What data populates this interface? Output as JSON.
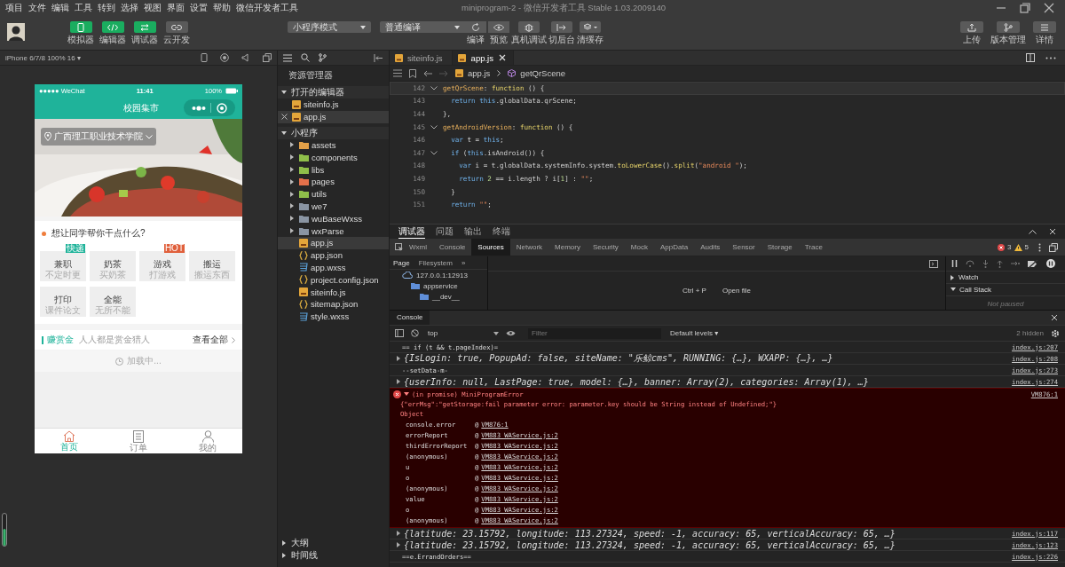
{
  "menu": [
    "项目",
    "文件",
    "编辑",
    "工具",
    "转到",
    "选择",
    "视图",
    "界面",
    "设置",
    "帮助",
    "微信开发者工具"
  ],
  "window": {
    "title": "miniprogram-2 - 微信开发者工具 Stable 1.03.2009140"
  },
  "toolbar": {
    "left_buttons": [
      {
        "label": "模拟器",
        "kind": "phone",
        "on": true
      },
      {
        "label": "编辑器",
        "kind": "code",
        "on": true
      },
      {
        "label": "调试器",
        "kind": "debug",
        "on": true
      },
      {
        "label": "云开发",
        "kind": "cloud",
        "on": false
      }
    ],
    "mode": "小程序模式",
    "compile": "普通编译",
    "actions": [
      {
        "label": "编译",
        "kind": "refresh"
      },
      {
        "label": "预览",
        "kind": "eye"
      },
      {
        "label": "真机调试",
        "kind": "bug"
      },
      {
        "label": "切后台",
        "kind": "switch"
      },
      {
        "label": "清缓存",
        "kind": "layers"
      }
    ],
    "right_buttons": [
      {
        "label": "上传",
        "kind": "upload"
      },
      {
        "label": "版本管理",
        "kind": "branch"
      },
      {
        "label": "详情",
        "kind": "menu"
      }
    ]
  },
  "simulator": {
    "device": "iPhone 6/7/8 100% 16 ▾",
    "phone": {
      "carrier": "●●●●● WeChat",
      "time": "11:41",
      "battery": "100%",
      "title": "校园集市",
      "location": "广西理工职业技术学院",
      "question": "想让同学帮你干点什么?",
      "services": [
        {
          "title": "兼职",
          "sub": "不定时更",
          "badge": "快递",
          "color": "#1fb39a"
        },
        {
          "title": "奶茶",
          "sub": "买奶茶"
        },
        {
          "title": "游戏",
          "sub": "打游戏",
          "badge": "HOT",
          "color": "#e0603c"
        },
        {
          "title": "搬运",
          "sub": "搬运东西"
        },
        {
          "title": "打印",
          "sub": "课件论文"
        },
        {
          "title": "全能",
          "sub": "无所不能"
        }
      ],
      "bounty": {
        "title": "赚赏金",
        "sub": "人人都是赏金猎人",
        "more": "查看全部",
        "loading": "加载中..."
      },
      "tabbar": [
        {
          "label": "首页",
          "kind": "home",
          "selected": true
        },
        {
          "label": "订单",
          "kind": "list",
          "selected": false
        },
        {
          "label": "我的",
          "kind": "user",
          "selected": false
        }
      ]
    }
  },
  "explorer": {
    "title": "资源管理器",
    "sections": [
      {
        "title": "打开的编辑器",
        "expanded": true,
        "items": [
          {
            "name": "siteinfo.js",
            "kind": "js",
            "selected": false
          },
          {
            "name": "app.js",
            "kind": "js",
            "selected": true
          }
        ]
      },
      {
        "title": "小程序",
        "expanded": true,
        "items": [
          {
            "name": "assets",
            "kind": "folder",
            "color": "#e3a048",
            "selected": false
          },
          {
            "name": "components",
            "kind": "folder",
            "color": "#8fbf4a",
            "selected": false
          },
          {
            "name": "libs",
            "kind": "folder",
            "color": "#8fbf4a",
            "selected": false
          },
          {
            "name": "pages",
            "kind": "folder",
            "color": "#e3704a",
            "selected": false
          },
          {
            "name": "utils",
            "kind": "folder",
            "color": "#8fbf4a",
            "selected": false
          },
          {
            "name": "we7",
            "kind": "folder",
            "color": "#8a95a3",
            "selected": false
          },
          {
            "name": "wuBaseWxss",
            "kind": "folder",
            "color": "#8a95a3",
            "selected": false
          },
          {
            "name": "wxParse",
            "kind": "folder",
            "color": "#8a95a3",
            "selected": false
          },
          {
            "name": "app.js",
            "kind": "js",
            "selected": true
          },
          {
            "name": "app.json",
            "kind": "json",
            "selected": false
          },
          {
            "name": "app.wxss",
            "kind": "wxss",
            "selected": false
          },
          {
            "name": "project.config.json",
            "kind": "json",
            "selected": false
          },
          {
            "name": "siteinfo.js",
            "kind": "js",
            "selected": false
          },
          {
            "name": "sitemap.json",
            "kind": "json",
            "selected": false
          },
          {
            "name": "style.wxss",
            "kind": "wxss",
            "selected": false
          }
        ]
      }
    ],
    "footer": [
      {
        "title": "大纲",
        "expanded": false
      },
      {
        "title": "时间线",
        "expanded": false
      }
    ]
  },
  "editor": {
    "tabs": [
      {
        "name": "siteinfo.js",
        "selected": false
      },
      {
        "name": "app.js",
        "selected": true
      }
    ],
    "breadcrumb": {
      "file": "app.js",
      "symbol": "getQrScene"
    },
    "lines": [
      {
        "n": "142",
        "fold": true,
        "current": true,
        "tokens": [
          {
            "t": "getQrScene",
            "kind": "prop"
          },
          {
            "t": ": ",
            "kind": "plain"
          },
          {
            "t": "function",
            "kind": "kw"
          },
          {
            "t": " () {",
            "kind": "plain"
          }
        ]
      },
      {
        "n": "143",
        "fold": false,
        "current": false,
        "tokens": [
          {
            "t": "  return ",
            "kind": "key"
          },
          {
            "t": "this",
            "kind": "key"
          },
          {
            "t": ".globalData.qrScene;",
            "kind": "plain"
          }
        ]
      },
      {
        "n": "144",
        "fold": false,
        "current": false,
        "tokens": [
          {
            "t": "},",
            "kind": "plain"
          }
        ]
      },
      {
        "n": "145",
        "fold": true,
        "current": false,
        "tokens": [
          {
            "t": "getAndroidVersion",
            "kind": "prop"
          },
          {
            "t": ": ",
            "kind": "plain"
          },
          {
            "t": "function",
            "kind": "kw"
          },
          {
            "t": " () {",
            "kind": "plain"
          }
        ]
      },
      {
        "n": "146",
        "fold": false,
        "current": false,
        "tokens": [
          {
            "t": "  var ",
            "kind": "key"
          },
          {
            "t": "t = ",
            "kind": "plain"
          },
          {
            "t": "this",
            "kind": "key"
          },
          {
            "t": ";",
            "kind": "plain"
          }
        ]
      },
      {
        "n": "147",
        "fold": true,
        "current": false,
        "tokens": [
          {
            "t": "  if ",
            "kind": "key"
          },
          {
            "t": "(",
            "kind": "plain"
          },
          {
            "t": "this",
            "kind": "key"
          },
          {
            "t": ".isAndroid()) {",
            "kind": "plain"
          }
        ]
      },
      {
        "n": "148",
        "fold": false,
        "current": false,
        "tokens": [
          {
            "t": "    var ",
            "kind": "key"
          },
          {
            "t": "i = t.globalData.systemInfo.system.",
            "kind": "plain"
          },
          {
            "t": "toLowerCase",
            "kind": "kw"
          },
          {
            "t": "().",
            "kind": "plain"
          },
          {
            "t": "split",
            "kind": "kw"
          },
          {
            "t": "(",
            "kind": "plain"
          },
          {
            "t": "\"android \"",
            "kind": "str"
          },
          {
            "t": ");",
            "kind": "plain"
          }
        ]
      },
      {
        "n": "149",
        "fold": false,
        "current": false,
        "tokens": [
          {
            "t": "    return ",
            "kind": "key"
          },
          {
            "t": "2",
            "kind": "num"
          },
          {
            "t": " == i.length ? i[",
            "kind": "plain"
          },
          {
            "t": "1",
            "kind": "num"
          },
          {
            "t": "] : ",
            "kind": "plain"
          },
          {
            "t": "\"\"",
            "kind": "str"
          },
          {
            "t": ";",
            "kind": "plain"
          }
        ]
      },
      {
        "n": "150",
        "fold": false,
        "current": false,
        "tokens": [
          {
            "t": "  }",
            "kind": "plain"
          }
        ]
      },
      {
        "n": "151",
        "fold": false,
        "current": false,
        "tokens": [
          {
            "t": "  return ",
            "kind": "key"
          },
          {
            "t": "\"\"",
            "kind": "str"
          },
          {
            "t": ";",
            "kind": "plain"
          }
        ]
      }
    ]
  },
  "devtools": {
    "panel_tabs": [
      {
        "label": "调试器",
        "selected": true
      },
      {
        "label": "问题",
        "selected": false
      },
      {
        "label": "输出",
        "selected": false
      },
      {
        "label": "终端",
        "selected": false
      }
    ],
    "tabs": [
      {
        "label": "Wxml",
        "selected": false
      },
      {
        "label": "Console",
        "selected": false
      },
      {
        "label": "Sources",
        "selected": true
      },
      {
        "label": "Network",
        "selected": false
      },
      {
        "label": "Memory",
        "selected": false
      },
      {
        "label": "Security",
        "selected": false
      },
      {
        "label": "Mock",
        "selected": false
      },
      {
        "label": "AppData",
        "selected": false
      },
      {
        "label": "Audits",
        "selected": false
      },
      {
        "label": "Sensor",
        "selected": false
      },
      {
        "label": "Storage",
        "selected": false
      },
      {
        "label": "Trace",
        "selected": false
      }
    ],
    "errors": "3",
    "warnings": "5",
    "sources": {
      "nav_tabs": [
        {
          "label": "Page",
          "selected": true
        },
        {
          "label": "Filesystem",
          "selected": false
        },
        {
          "label": "»",
          "selected": false
        }
      ],
      "tree": [
        {
          "name": "127.0.0.1:12913",
          "kind": "origin",
          "children": [
            {
              "name": "appservice",
              "kind": "folder",
              "children": [
                {
                  "name": "__dev__",
                  "kind": "folder"
                }
              ]
            }
          ]
        }
      ],
      "shortcut": "Ctrl + P",
      "shortcut_action": "Open file",
      "watch": "Watch",
      "call_stack": "Call Stack",
      "not_paused": "Not paused"
    },
    "drawer_tab": "Console",
    "console": {
      "context": "top",
      "filter_placeholder": "Filter",
      "levels": "Default levels ▾",
      "hidden": "2 hidden",
      "messages": [
        {
          "kind": "log",
          "text": "== if (t && t.pageIndex)=",
          "source": "index.js:207"
        },
        {
          "kind": "object",
          "text": "{IsLogin: true, PopupAd: false, siteName: \"乐鲸cms\", RUNNING: {…}, WXAPP: {…}, …}",
          "source": "index.js:208"
        },
        {
          "kind": "log",
          "text": "--setData-m-",
          "source": "index.js:273"
        },
        {
          "kind": "object",
          "text": "{userInfo: null, LastPage: true, model: {…}, banner: Array(2), categories: Array(1), …}",
          "source": "index.js:274"
        },
        {
          "kind": "error",
          "text": "(in promise) MiniProgramError",
          "detail": "{\"errMsg\":\"getStorage:fail parameter error: parameter.key should be String instead of Undefined;\"}",
          "object": "Object",
          "source": "VM876:1",
          "stack": [
            {
              "fn": "console.error",
              "at": "@",
              "loc": "VM876:1"
            },
            {
              "fn": "errorReport",
              "at": "@",
              "loc": "VM883 WAService.js:2"
            },
            {
              "fn": "thirdErrorReport",
              "at": "@",
              "loc": "VM883 WAService.js:2"
            },
            {
              "fn": "(anonymous)",
              "at": "@",
              "loc": "VM883 WAService.js:2"
            },
            {
              "fn": "u",
              "at": "@",
              "loc": "VM883 WAService.js:2"
            },
            {
              "fn": "o",
              "at": "@",
              "loc": "VM883 WAService.js:2"
            },
            {
              "fn": "(anonymous)",
              "at": "@",
              "loc": "VM883 WAService.js:2"
            },
            {
              "fn": "value",
              "at": "@",
              "loc": "VM883 WAService.js:2"
            },
            {
              "fn": "o",
              "at": "@",
              "loc": "VM883 WAService.js:2"
            },
            {
              "fn": "(anonymous)",
              "at": "@",
              "loc": "VM883 WAService.js:2"
            }
          ]
        },
        {
          "kind": "object",
          "text": "{latitude: 23.15792, longitude: 113.27324, speed: -1, accuracy: 65, verticalAccuracy: 65, …}",
          "source": "index.js:117"
        },
        {
          "kind": "object",
          "text": "{latitude: 23.15792, longitude: 113.27324, speed: -1, accuracy: 65, verticalAccuracy: 65, …}",
          "source": "index.js:123"
        },
        {
          "kind": "log",
          "text": "==e.ErrandOrders==",
          "source": "index.js:226"
        }
      ]
    }
  }
}
